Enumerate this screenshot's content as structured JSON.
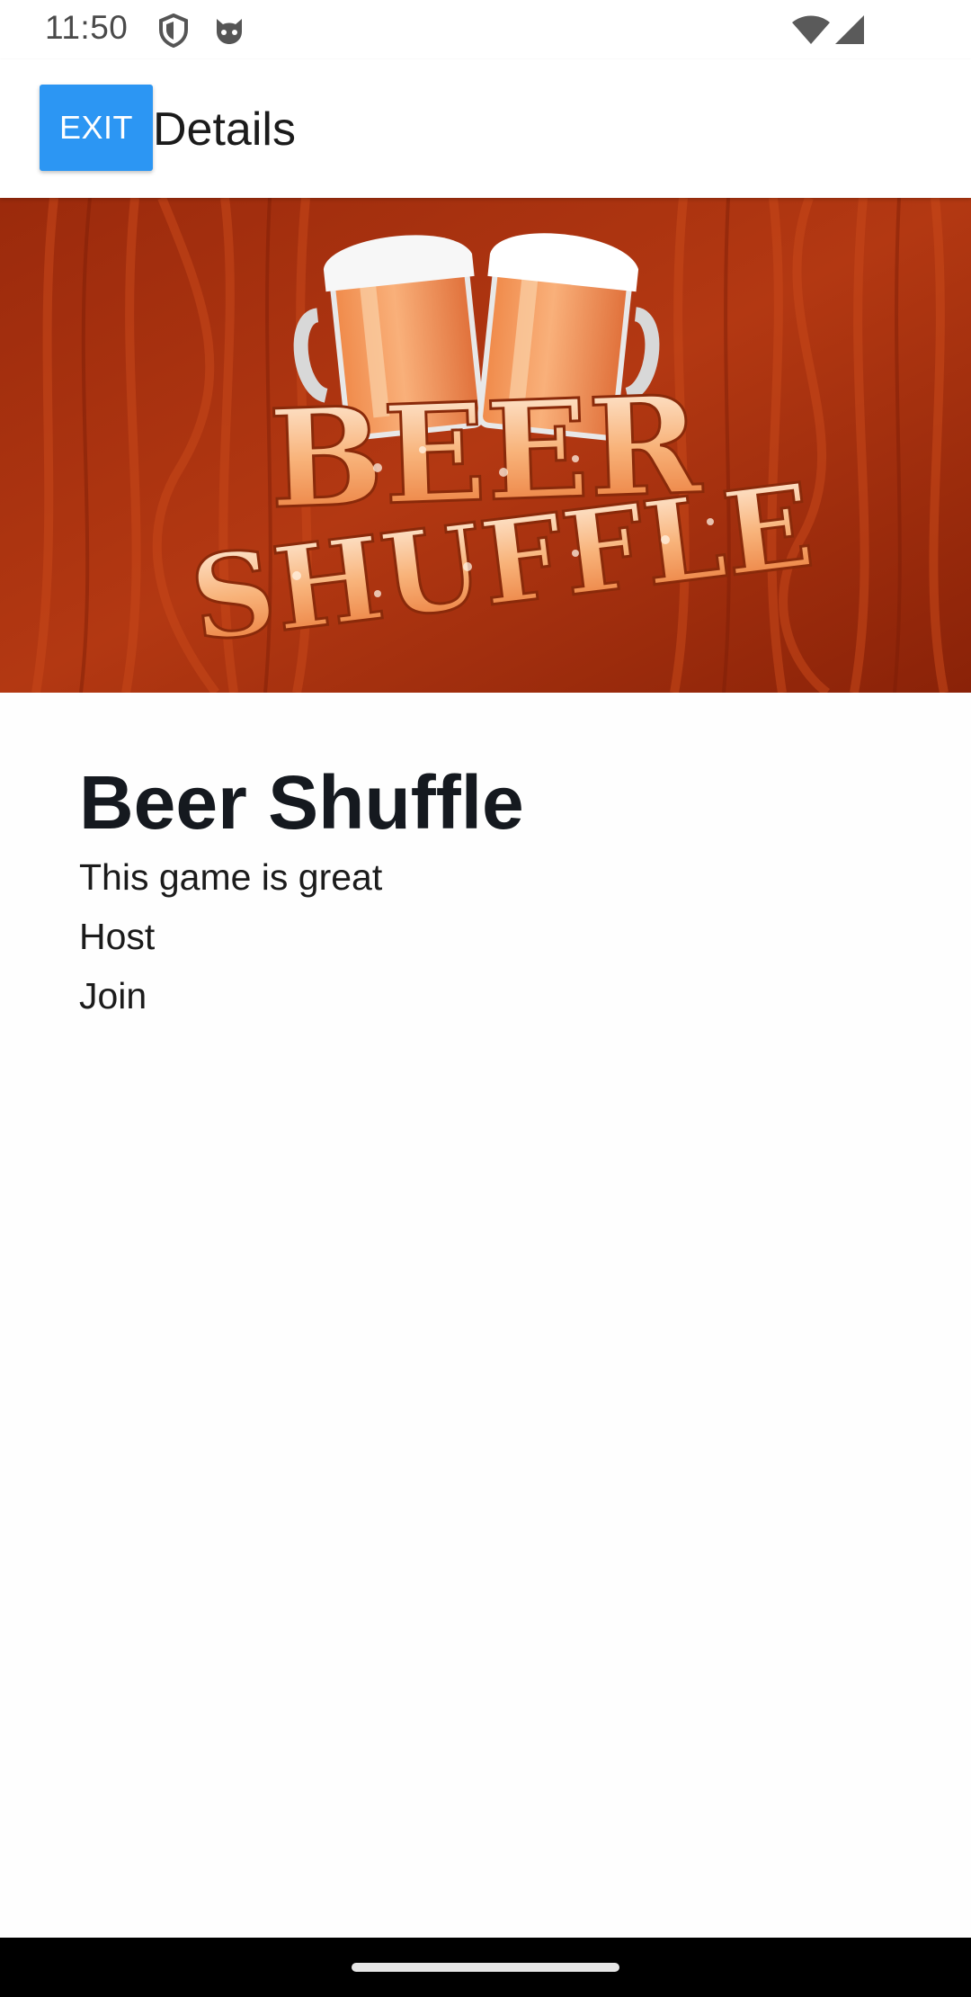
{
  "status_bar": {
    "time": "11:50",
    "icons": [
      "shield-icon",
      "cat-icon",
      "wifi-icon",
      "signal-icon"
    ]
  },
  "app_bar": {
    "exit_label": "EXIT",
    "title": "Details"
  },
  "banner": {
    "logo_text_line1": "BEER",
    "logo_text_line2": "SHUFFLE",
    "background_color": "#a83010",
    "text_color": "#f5a060"
  },
  "game": {
    "title": "Beer Shuffle",
    "description": "This game is great",
    "host_label": "Host",
    "join_label": "Join"
  },
  "colors": {
    "accent": "#2c96f3"
  }
}
